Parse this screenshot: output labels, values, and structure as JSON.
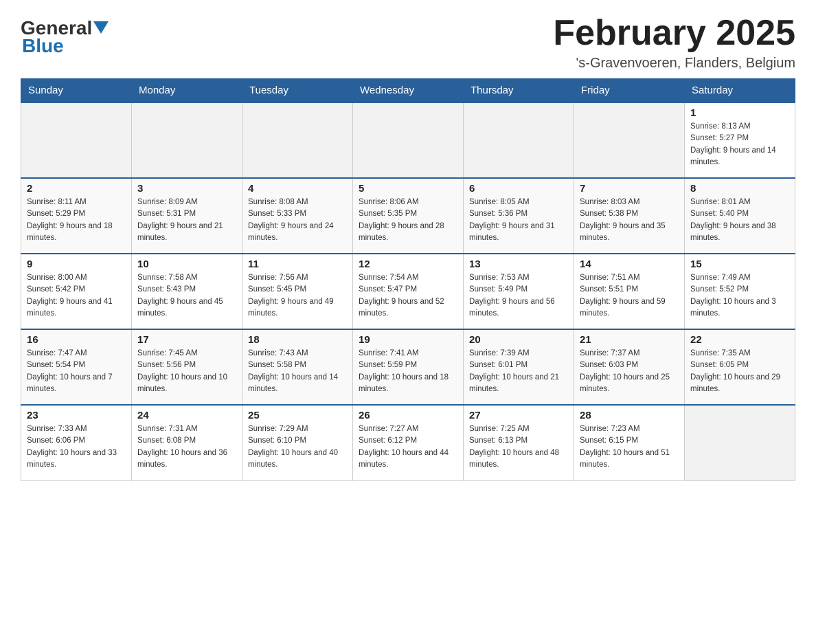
{
  "header": {
    "logo": {
      "text_general": "General",
      "text_blue": "Blue",
      "alt": "GeneralBlue logo"
    },
    "title": "February 2025",
    "subtitle": "'s-Gravenvoeren, Flanders, Belgium"
  },
  "weekdays": [
    "Sunday",
    "Monday",
    "Tuesday",
    "Wednesday",
    "Thursday",
    "Friday",
    "Saturday"
  ],
  "weeks": [
    [
      {
        "day": "",
        "info": ""
      },
      {
        "day": "",
        "info": ""
      },
      {
        "day": "",
        "info": ""
      },
      {
        "day": "",
        "info": ""
      },
      {
        "day": "",
        "info": ""
      },
      {
        "day": "",
        "info": ""
      },
      {
        "day": "1",
        "info": "Sunrise: 8:13 AM\nSunset: 5:27 PM\nDaylight: 9 hours and 14 minutes."
      }
    ],
    [
      {
        "day": "2",
        "info": "Sunrise: 8:11 AM\nSunset: 5:29 PM\nDaylight: 9 hours and 18 minutes."
      },
      {
        "day": "3",
        "info": "Sunrise: 8:09 AM\nSunset: 5:31 PM\nDaylight: 9 hours and 21 minutes."
      },
      {
        "day": "4",
        "info": "Sunrise: 8:08 AM\nSunset: 5:33 PM\nDaylight: 9 hours and 24 minutes."
      },
      {
        "day": "5",
        "info": "Sunrise: 8:06 AM\nSunset: 5:35 PM\nDaylight: 9 hours and 28 minutes."
      },
      {
        "day": "6",
        "info": "Sunrise: 8:05 AM\nSunset: 5:36 PM\nDaylight: 9 hours and 31 minutes."
      },
      {
        "day": "7",
        "info": "Sunrise: 8:03 AM\nSunset: 5:38 PM\nDaylight: 9 hours and 35 minutes."
      },
      {
        "day": "8",
        "info": "Sunrise: 8:01 AM\nSunset: 5:40 PM\nDaylight: 9 hours and 38 minutes."
      }
    ],
    [
      {
        "day": "9",
        "info": "Sunrise: 8:00 AM\nSunset: 5:42 PM\nDaylight: 9 hours and 41 minutes."
      },
      {
        "day": "10",
        "info": "Sunrise: 7:58 AM\nSunset: 5:43 PM\nDaylight: 9 hours and 45 minutes."
      },
      {
        "day": "11",
        "info": "Sunrise: 7:56 AM\nSunset: 5:45 PM\nDaylight: 9 hours and 49 minutes."
      },
      {
        "day": "12",
        "info": "Sunrise: 7:54 AM\nSunset: 5:47 PM\nDaylight: 9 hours and 52 minutes."
      },
      {
        "day": "13",
        "info": "Sunrise: 7:53 AM\nSunset: 5:49 PM\nDaylight: 9 hours and 56 minutes."
      },
      {
        "day": "14",
        "info": "Sunrise: 7:51 AM\nSunset: 5:51 PM\nDaylight: 9 hours and 59 minutes."
      },
      {
        "day": "15",
        "info": "Sunrise: 7:49 AM\nSunset: 5:52 PM\nDaylight: 10 hours and 3 minutes."
      }
    ],
    [
      {
        "day": "16",
        "info": "Sunrise: 7:47 AM\nSunset: 5:54 PM\nDaylight: 10 hours and 7 minutes."
      },
      {
        "day": "17",
        "info": "Sunrise: 7:45 AM\nSunset: 5:56 PM\nDaylight: 10 hours and 10 minutes."
      },
      {
        "day": "18",
        "info": "Sunrise: 7:43 AM\nSunset: 5:58 PM\nDaylight: 10 hours and 14 minutes."
      },
      {
        "day": "19",
        "info": "Sunrise: 7:41 AM\nSunset: 5:59 PM\nDaylight: 10 hours and 18 minutes."
      },
      {
        "day": "20",
        "info": "Sunrise: 7:39 AM\nSunset: 6:01 PM\nDaylight: 10 hours and 21 minutes."
      },
      {
        "day": "21",
        "info": "Sunrise: 7:37 AM\nSunset: 6:03 PM\nDaylight: 10 hours and 25 minutes."
      },
      {
        "day": "22",
        "info": "Sunrise: 7:35 AM\nSunset: 6:05 PM\nDaylight: 10 hours and 29 minutes."
      }
    ],
    [
      {
        "day": "23",
        "info": "Sunrise: 7:33 AM\nSunset: 6:06 PM\nDaylight: 10 hours and 33 minutes."
      },
      {
        "day": "24",
        "info": "Sunrise: 7:31 AM\nSunset: 6:08 PM\nDaylight: 10 hours and 36 minutes."
      },
      {
        "day": "25",
        "info": "Sunrise: 7:29 AM\nSunset: 6:10 PM\nDaylight: 10 hours and 40 minutes."
      },
      {
        "day": "26",
        "info": "Sunrise: 7:27 AM\nSunset: 6:12 PM\nDaylight: 10 hours and 44 minutes."
      },
      {
        "day": "27",
        "info": "Sunrise: 7:25 AM\nSunset: 6:13 PM\nDaylight: 10 hours and 48 minutes."
      },
      {
        "day": "28",
        "info": "Sunrise: 7:23 AM\nSunset: 6:15 PM\nDaylight: 10 hours and 51 minutes."
      },
      {
        "day": "",
        "info": ""
      }
    ]
  ]
}
